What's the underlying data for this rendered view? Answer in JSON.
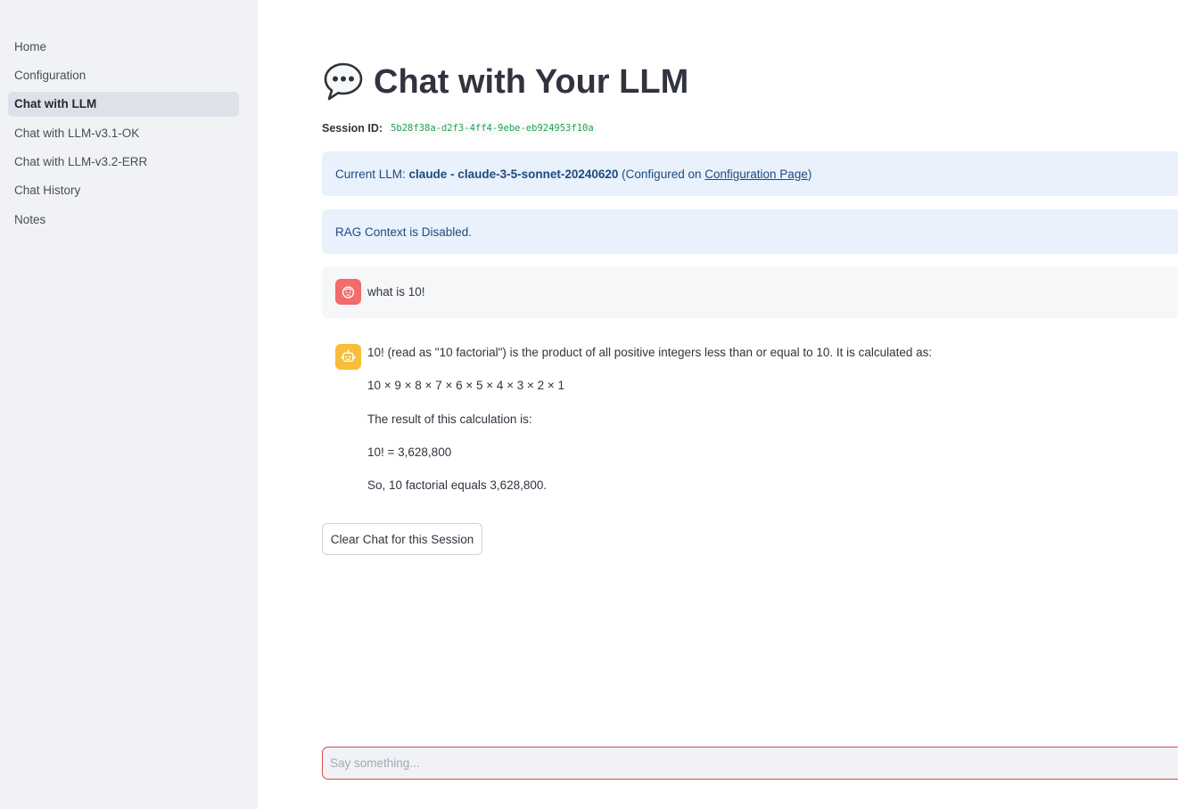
{
  "sidebar": {
    "items": [
      {
        "label": "Home"
      },
      {
        "label": "Configuration"
      },
      {
        "label": "Chat with LLM"
      },
      {
        "label": "Chat with LLM-v3.1-OK"
      },
      {
        "label": "Chat with LLM-v3.2-ERR"
      },
      {
        "label": "Chat History"
      },
      {
        "label": "Notes"
      }
    ],
    "active": "Chat with LLM"
  },
  "header": {
    "icon": "speech-balloon-icon",
    "title": "Chat with Your LLM"
  },
  "session": {
    "label": "Session ID:",
    "id": "5b28f38a-d2f3-4ff4-9ebe-eb924953f10a"
  },
  "llm_info": {
    "prefix": "Current LLM: ",
    "model": "claude - claude-3-5-sonnet-20240620",
    "middle": " (Configured on ",
    "link": "Configuration Page",
    "suffix": ")"
  },
  "rag_info": {
    "text": "RAG Context is Disabled."
  },
  "messages": {
    "user": {
      "avatar_icon": "user-face-icon",
      "text": "what is 10!"
    },
    "assistant": {
      "avatar_icon": "robot-icon",
      "lines": [
        "10! (read as \"10 factorial\") is the product of all positive integers less than or equal to 10. It is calculated as:",
        "10 × 9 × 8 × 7 × 6 × 5 × 4 × 3 × 2 × 1",
        "The result of this calculation is:",
        "10! = 3,628,800",
        "So, 10 factorial equals 3,628,800."
      ]
    }
  },
  "actions": {
    "clear_label": "Clear Chat for this Session"
  },
  "chat_input": {
    "placeholder": "Say something...",
    "value": ""
  },
  "colors": {
    "sidebar_bg": "#f0f2f6",
    "info_bg": "#e8f1fc",
    "info_text": "#1f4a7e",
    "user_avatar": "#f46b6b",
    "bot_avatar": "#f8be3a",
    "input_border": "#e04848",
    "session_id": "#21a055"
  }
}
